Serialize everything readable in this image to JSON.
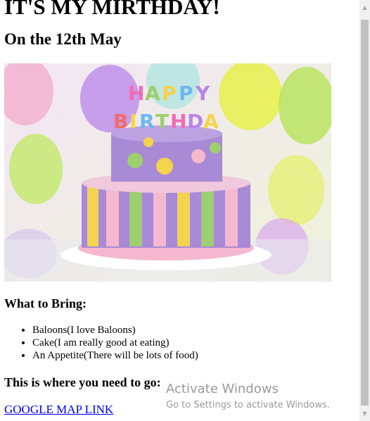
{
  "page": {
    "title": "IT'S MY MIRTHDAY!",
    "subtitle": "On the 12th May",
    "image": {
      "label": "HAPPY BIRTHDAY",
      "colors": {
        "balloon_yellow": "#e8f04a",
        "balloon_purple": "#b884ea",
        "balloon_pink": "#f4a6c8",
        "cake_purple": "#a98ad6",
        "dot_yellow": "#f4d34e",
        "dot_green": "#9ccf6e",
        "ribbon_pink": "#f5b8cf"
      }
    },
    "bring_heading": "What to Bring:",
    "bring_items": [
      "Baloons(I love Baloons)",
      "Cake(I am really good at eating)",
      "An Appetite(There will be lots of food)"
    ],
    "go_heading": "This is where you need to go:",
    "map_link": "GOOGLE MAP LINK"
  },
  "watermark": {
    "title": "Activate Windows",
    "subtitle": "Go to Settings to activate Windows."
  },
  "colors": {
    "link": "#0000ee",
    "scrollbar_track": "#f0f0f0",
    "scrollbar_thumb": "#c1c1c1"
  }
}
